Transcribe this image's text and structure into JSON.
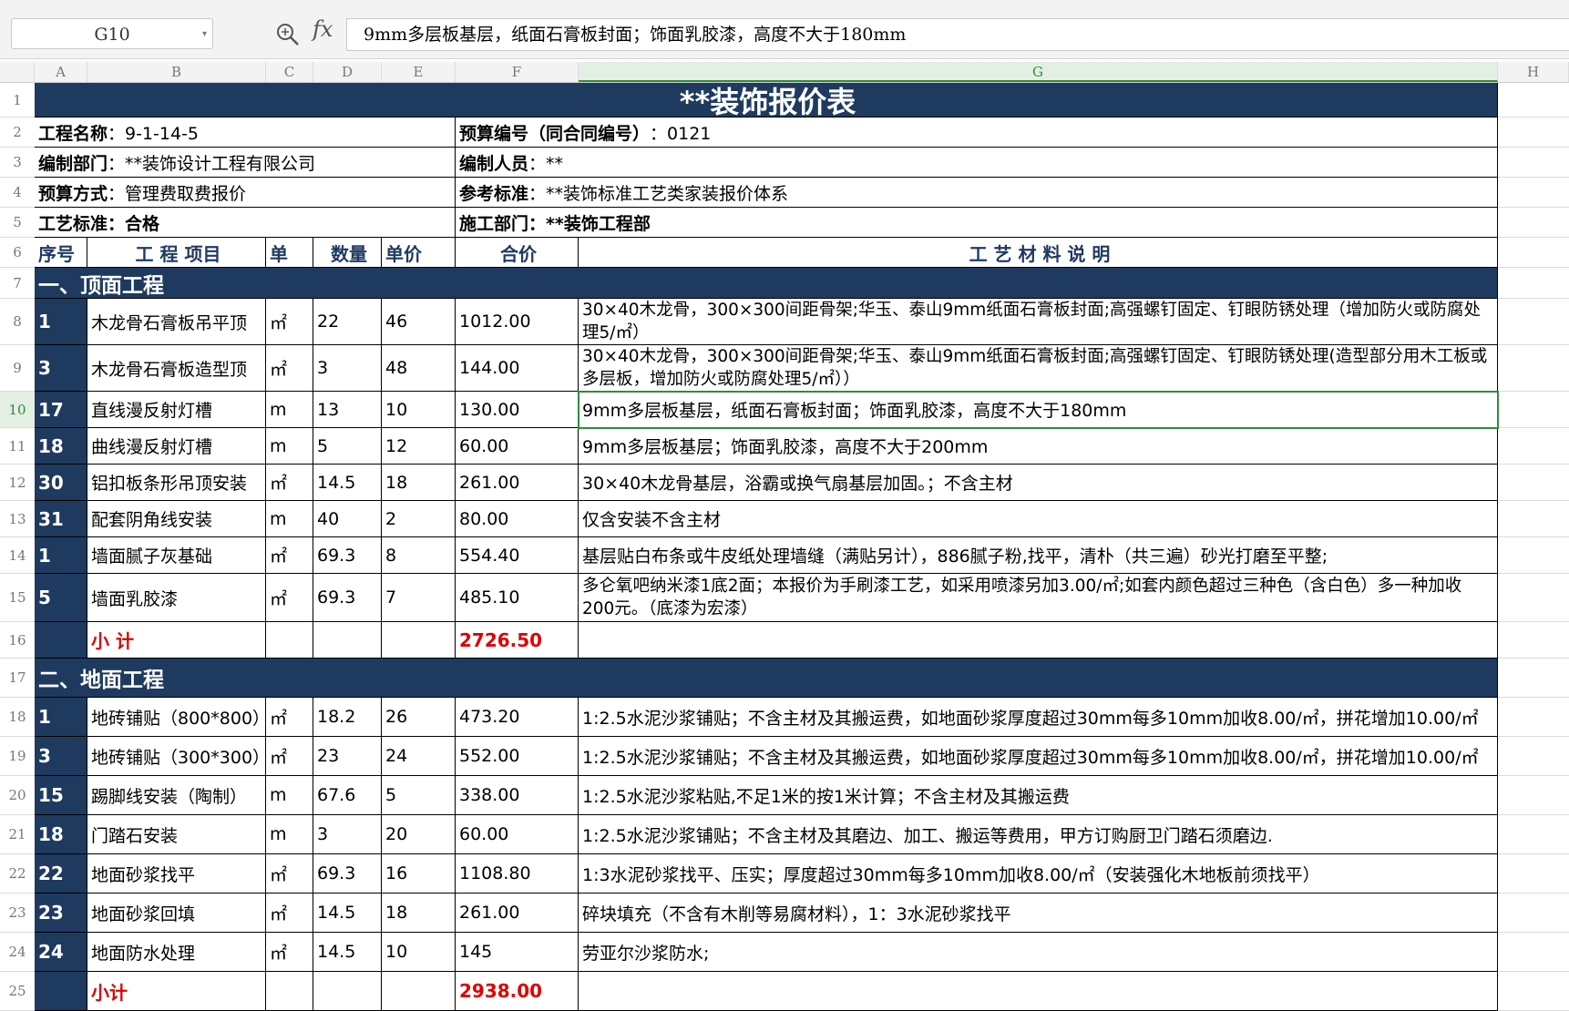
{
  "toolbar": {
    "name_box": "G10",
    "zoom_icon": "zoom-formula-icon",
    "fx_label": "fx",
    "formula_value": "9mm多层板基层，纸面石膏板封面；饰面乳胶漆，高度不大于180mm"
  },
  "columns": [
    "A",
    "B",
    "C",
    "D",
    "E",
    "F",
    "G",
    "H"
  ],
  "active_column": "G",
  "active_row": "10",
  "colors": {
    "header_bg": "#1f3a5f",
    "accent_green": "#2f8c3a",
    "subtotal_red": "#e00000"
  },
  "sheet": {
    "title": "**装饰报价表",
    "info": [
      {
        "l_label": "工程名称",
        "l_value": "：9-1-14-5",
        "r_label": "预算编号（同合同编号）",
        "r_value": "：0121"
      },
      {
        "l_label": "编制部门",
        "l_value": "：**装饰设计工程有限公司",
        "r_label": "编制人员",
        "r_value": "：**"
      },
      {
        "l_label": "预算方式",
        "l_value": "：管理费取费报价",
        "r_label": "参考标准",
        "r_value": "：**装饰标准工艺类家装报价体系"
      },
      {
        "l_label": "工艺标准：合格",
        "l_value": "",
        "r_label": "施工部门：**装饰工程部",
        "r_value": ""
      }
    ],
    "headers": [
      "序号",
      "工 程 项目",
      "单",
      "数量",
      "单价",
      "合价",
      "工 艺 材 料 说 明"
    ],
    "section1_title": "一、顶面工程",
    "section1_rows": [
      {
        "no": "1",
        "item": "木龙骨石膏板吊平顶",
        "unit": "㎡",
        "qty": "22",
        "price": "46",
        "total": "1012.00",
        "desc": "30×40木龙骨，300×300间距骨架;华玉、泰山9mm纸面石膏板封面;高强螺钉固定、钉眼防锈处理（增加防火或防腐处理5/㎡）"
      },
      {
        "no": "3",
        "item": "木龙骨石膏板造型顶",
        "unit": "㎡",
        "qty": "3",
        "price": "48",
        "total": "144.00",
        "desc": "30×40木龙骨，300×300间距骨架;华玉、泰山9mm纸面石膏板封面;高强螺钉固定、钉眼防锈处理(造型部分用木工板或多层板，增加防火或防腐处理5/㎡））"
      },
      {
        "no": "17",
        "item": "直线漫反射灯槽",
        "unit": "m",
        "qty": "13",
        "price": "10",
        "total": "130.00",
        "desc": "9mm多层板基层，纸面石膏板封面；饰面乳胶漆，高度不大于180mm"
      },
      {
        "no": "18",
        "item": "曲线漫反射灯槽",
        "unit": "m",
        "qty": "5",
        "price": "12",
        "total": "60.00",
        "desc": "9mm多层板基层；饰面乳胶漆，高度不大于200mm"
      },
      {
        "no": "30",
        "item": "铝扣板条形吊顶安装",
        "unit": "㎡",
        "qty": "14.5",
        "price": "18",
        "total": "261.00",
        "desc": "30×40木龙骨基层，浴霸或换气扇基层加固。；不含主材"
      },
      {
        "no": "31",
        "item": "配套阴角线安装",
        "unit": "m",
        "qty": "40",
        "price": "2",
        "total": "80.00",
        "desc": "仅含安装不含主材"
      },
      {
        "no": "1",
        "item": "墙面腻子灰基础",
        "unit": "㎡",
        "qty": "69.3",
        "price": "8",
        "total": "554.40",
        "desc": "基层贴白布条或牛皮纸处理墙缝（满贴另计），886腻子粉,找平，清朴（共三遍）砂光打磨至平整;"
      },
      {
        "no": "5",
        "item": "墙面乳胶漆",
        "unit": "㎡",
        "qty": "69.3",
        "price": "7",
        "total": "485.10",
        "desc": "多仑氧吧纳米漆1底2面；本报价为手刷漆工艺，如采用喷漆另加3.00/㎡;如套内颜色超过三种色（含白色）多一种加收200元。（底漆为宏漆）"
      }
    ],
    "section1_subtotal_label": "小 计",
    "section1_subtotal": "2726.50",
    "section2_title": "二、地面工程",
    "section2_rows": [
      {
        "no": "1",
        "item": "地砖铺贴（800*800）",
        "unit": "㎡",
        "qty": "18.2",
        "price": "26",
        "total": "473.20",
        "desc": "1:2.5水泥沙浆铺贴；不含主材及其搬运费，如地面砂浆厚度超过30mm每多10mm加收8.00/㎡，拼花增加10.00/㎡"
      },
      {
        "no": "3",
        "item": "地砖铺贴（300*300）",
        "unit": "㎡",
        "qty": "23",
        "price": "24",
        "total": "552.00",
        "desc": "1:2.5水泥沙浆铺贴；不含主材及其搬运费，如地面砂浆厚度超过30mm每多10mm加收8.00/㎡，拼花增加10.00/㎡"
      },
      {
        "no": "15",
        "item": "踢脚线安装（陶制）",
        "unit": "m",
        "qty": "67.6",
        "price": "5",
        "total": "338.00",
        "desc": "1:2.5水泥沙浆粘贴,不足1米的按1米计算；不含主材及其搬运费"
      },
      {
        "no": "18",
        "item": "门踏石安装",
        "unit": "m",
        "qty": "3",
        "price": "20",
        "total": "60.00",
        "desc": "1:2.5水泥沙浆铺贴；不含主材及其磨边、加工、搬运等费用，甲方订购厨卫门踏石须磨边."
      },
      {
        "no": "22",
        "item": "地面砂浆找平",
        "unit": "㎡",
        "qty": "69.3",
        "price": "16",
        "total": "1108.80",
        "desc": "1:3水泥砂浆找平、压实；厚度超过30mm每多10mm加收8.00/㎡（安装强化木地板前须找平）"
      },
      {
        "no": "23",
        "item": "地面砂浆回填",
        "unit": "㎡",
        "qty": "14.5",
        "price": "18",
        "total": "261.00",
        "desc": "碎块填充（不含有木削等易腐材料），1：3水泥砂浆找平"
      },
      {
        "no": "24",
        "item": "地面防水处理",
        "unit": "㎡",
        "qty": "14.5",
        "price": "10",
        "total": "145",
        "desc": "劳亚尔沙浆防水;"
      }
    ],
    "section2_subtotal_label": "小计",
    "section2_subtotal": "2938.00"
  }
}
